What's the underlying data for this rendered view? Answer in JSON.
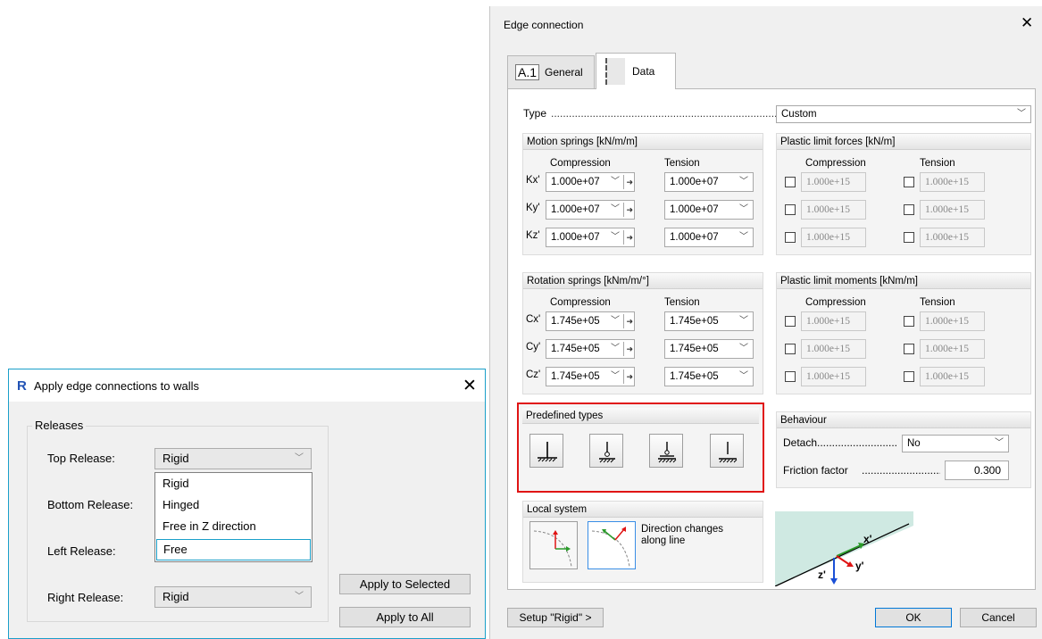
{
  "edge_dialog": {
    "title": "Edge connection",
    "close_glyph": "✕",
    "tabs": [
      {
        "label": "General",
        "icon_text": "A.1"
      },
      {
        "label": "Data"
      }
    ],
    "type": {
      "label": "Type",
      "dots": "......................................................................................",
      "value": "Custom"
    },
    "motion_springs": {
      "title": "Motion springs [kN/m/m]",
      "compression_label": "Compression",
      "tension_label": "Tension",
      "rows": [
        {
          "label": "Kx'",
          "compression": "1.000e+07",
          "tension": "1.000e+07"
        },
        {
          "label": "Ky'",
          "compression": "1.000e+07",
          "tension": "1.000e+07"
        },
        {
          "label": "Kz'",
          "compression": "1.000e+07",
          "tension": "1.000e+07"
        }
      ]
    },
    "plastic_forces": {
      "title": "Plastic limit forces [kN/m]",
      "compression_label": "Compression",
      "tension_label": "Tension",
      "rows": [
        {
          "compression": "1.000e+15",
          "tension": "1.000e+15"
        },
        {
          "compression": "1.000e+15",
          "tension": "1.000e+15"
        },
        {
          "compression": "1.000e+15",
          "tension": "1.000e+15"
        }
      ]
    },
    "rotation_springs": {
      "title": "Rotation springs [kNm/m/°]",
      "compression_label": "Compression",
      "tension_label": "Tension",
      "rows": [
        {
          "label": "Cx'",
          "compression": "1.745e+05",
          "tension": "1.745e+05"
        },
        {
          "label": "Cy'",
          "compression": "1.745e+05",
          "tension": "1.745e+05"
        },
        {
          "label": "Cz'",
          "compression": "1.745e+05",
          "tension": "1.745e+05"
        }
      ]
    },
    "plastic_moments": {
      "title": "Plastic limit moments [kNm/m]",
      "compression_label": "Compression",
      "tension_label": "Tension",
      "rows": [
        {
          "compression": "1.000e+15",
          "tension": "1.000e+15"
        },
        {
          "compression": "1.000e+15",
          "tension": "1.000e+15"
        },
        {
          "compression": "1.000e+15",
          "tension": "1.000e+15"
        }
      ]
    },
    "predefined": {
      "title": "Predefined types"
    },
    "behaviour": {
      "title": "Behaviour",
      "detach_label": "Detach",
      "detach_dots": "..............................",
      "detach_value": "No",
      "friction_label": "Friction factor",
      "friction_dots": "...........................",
      "friction_value": "0.300"
    },
    "local_system": {
      "title": "Local system",
      "option_text": "Direction changes along line"
    },
    "axes": {
      "x": "x'",
      "y": "y'",
      "z": "z'"
    },
    "buttons": {
      "setup": "Setup \"Rigid\" >",
      "ok": "OK",
      "cancel": "Cancel"
    },
    "colors": {
      "selection_border": "#e01414",
      "accent": "#0078d7",
      "diagram_fill": "#cfe9e2"
    }
  },
  "apply_dialog": {
    "logo": "R",
    "title": "Apply edge connections to walls",
    "close_glyph": "✕",
    "group_label": "Releases",
    "top_label": "Top Release:",
    "top_value": "Rigid",
    "bottom_label": "Bottom Release:",
    "left_label": "Left Release:",
    "right_label": "Right Release:",
    "right_value": "Rigid",
    "dropdown_options": [
      "Rigid",
      "Hinged",
      "Free in Z direction",
      "Free"
    ],
    "selected_option": "Free",
    "apply_selected": "Apply to Selected",
    "apply_all": "Apply to All"
  }
}
